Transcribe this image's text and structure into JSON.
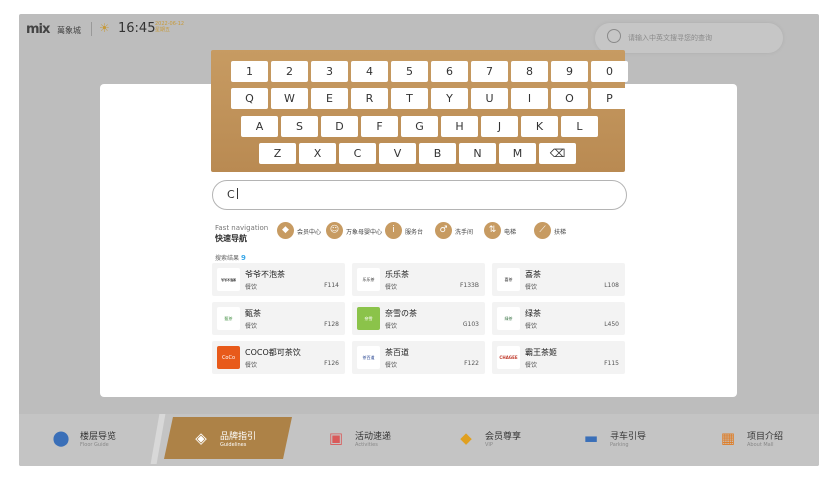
{
  "header": {
    "logo_main": "mix",
    "logo_sub": "萬象城",
    "time": "16:45",
    "date_line1": "2022-06-12",
    "date_line2": "星期五",
    "search_placeholder": "请输入中英文搜寻您的查询"
  },
  "keyboard": {
    "rows": [
      [
        "1",
        "2",
        "3",
        "4",
        "5",
        "6",
        "7",
        "8",
        "9",
        "0"
      ],
      [
        "Q",
        "W",
        "E",
        "R",
        "T",
        "Y",
        "U",
        "I",
        "O",
        "P"
      ],
      [
        "A",
        "S",
        "D",
        "F",
        "G",
        "H",
        "J",
        "K",
        "L"
      ],
      [
        "Z",
        "X",
        "C",
        "V",
        "B",
        "N",
        "M",
        "⌫"
      ]
    ]
  },
  "search_input": {
    "value": "C"
  },
  "fast_nav": {
    "label_en": "Fast navigation",
    "label_cn": "快速导航",
    "items": [
      {
        "label": "会员中心",
        "icon": "diamond-icon"
      },
      {
        "label": "万象母婴中心",
        "icon": "baby-icon"
      },
      {
        "label": "服务台",
        "icon": "info-icon"
      },
      {
        "label": "洗手间",
        "icon": "restroom-icon"
      },
      {
        "label": "电梯",
        "icon": "elevator-icon"
      },
      {
        "label": "扶梯",
        "icon": "escalator-icon"
      }
    ]
  },
  "results": {
    "label": "搜索结果",
    "count": "9",
    "items": [
      {
        "name": "爷爷不泡茶",
        "category": "餐饮",
        "floor": "F114",
        "logo": "爷爷不泡茶"
      },
      {
        "name": "乐乐茶",
        "category": "餐饮",
        "floor": "F133B",
        "logo": "乐乐茶"
      },
      {
        "name": "喜茶",
        "category": "餐饮",
        "floor": "L108",
        "logo": "喜茶"
      },
      {
        "name": "甄茶",
        "category": "餐饮",
        "floor": "F128",
        "logo": "甄茶"
      },
      {
        "name": "奈雪の茶",
        "category": "餐饮",
        "floor": "G103",
        "logo": "奈雪"
      },
      {
        "name": "绿茶",
        "category": "餐饮",
        "floor": "L450",
        "logo": "绿茶"
      },
      {
        "name": "COCO都可茶饮",
        "category": "餐饮",
        "floor": "F126",
        "logo": "CoCo"
      },
      {
        "name": "茶百道",
        "category": "餐饮",
        "floor": "F122",
        "logo": "茶百道"
      },
      {
        "name": "霸王茶姬",
        "category": "餐饮",
        "floor": "F115",
        "logo": "CHAGEE"
      }
    ]
  },
  "bottom_nav": {
    "items": [
      {
        "label": "楼层导览",
        "sub": "Floor Guide",
        "icon": "location-pin-icon"
      },
      {
        "label": "品牌指引",
        "sub": "Guidelines",
        "icon": "tag-icon"
      },
      {
        "label": "活动速递",
        "sub": "Activities",
        "icon": "gift-icon"
      },
      {
        "label": "会员尊享",
        "sub": "VIP",
        "icon": "diamond-icon"
      },
      {
        "label": "寻车引导",
        "sub": "Parking",
        "icon": "car-icon"
      },
      {
        "label": "项目介绍",
        "sub": "About Mall",
        "icon": "grid-icon"
      }
    ],
    "active_index": 1
  },
  "colors": {
    "accent": "#c79b62",
    "active_tab": "#ad8247",
    "count": "#3aa8e8"
  }
}
